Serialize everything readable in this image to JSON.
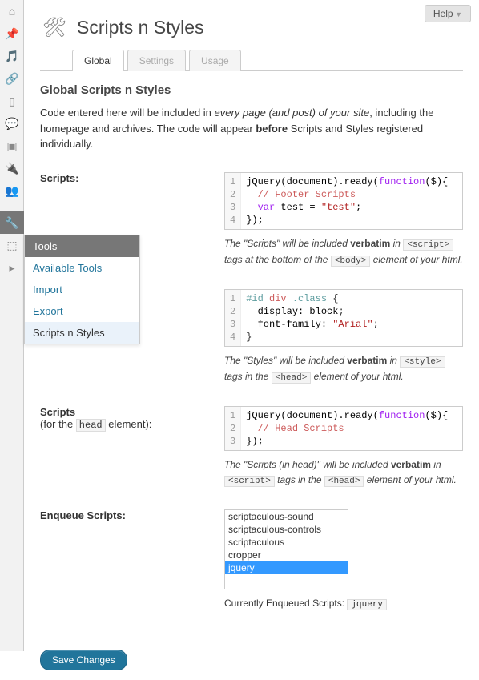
{
  "help_button": "Help",
  "page_title": "Scripts n Styles",
  "tabs": [
    {
      "label": "Global",
      "active": true
    },
    {
      "label": "Settings",
      "active": false
    },
    {
      "label": "Usage",
      "active": false
    }
  ],
  "section_title": "Global Scripts n Styles",
  "intro": {
    "p1a": "Code entered here will be included in ",
    "p1em": "every page (and post) of your site",
    "p1b": ", including the homepage and archives. The code will appear ",
    "p1strong": "before",
    "p1c": " Scripts and Styles registered individually."
  },
  "rows": {
    "scripts": {
      "label": "Scripts:",
      "code": [
        [
          {
            "t": "jQuery(document).ready(",
            "c": "jq"
          },
          {
            "t": "function",
            "c": "kw"
          },
          {
            "t": "($){",
            "c": "jq"
          }
        ],
        [
          {
            "t": "  // Footer Scripts",
            "c": "com"
          }
        ],
        [
          {
            "t": "  ",
            "c": "jq"
          },
          {
            "t": "var",
            "c": "kw"
          },
          {
            "t": " test = ",
            "c": "jq"
          },
          {
            "t": "\"test\"",
            "c": "str"
          },
          {
            "t": ";",
            "c": "jq"
          }
        ],
        [
          {
            "t": "});",
            "c": "jq"
          }
        ]
      ],
      "desc": {
        "a": "The \"Scripts\" will be included ",
        "strong": "verbatim",
        "b": " in ",
        "code1": "<script>",
        "c": " tags at the bottom of the ",
        "code2": "<body>",
        "d": " element of your html."
      }
    },
    "styles": {
      "code": [
        [
          {
            "t": "#id",
            "c": "sel"
          },
          {
            "t": " ",
            "c": ""
          },
          {
            "t": "div",
            "c": "tag"
          },
          {
            "t": " ",
            "c": ""
          },
          {
            "t": ".class",
            "c": "sel"
          },
          {
            "t": " {",
            "c": ""
          }
        ],
        [
          {
            "t": "  display: ",
            "c": "prop"
          },
          {
            "t": "block",
            "c": "jq"
          },
          {
            "t": ";",
            "c": ""
          }
        ],
        [
          {
            "t": "  font-family: ",
            "c": "prop"
          },
          {
            "t": "\"Arial\"",
            "c": "str"
          },
          {
            "t": ";",
            "c": ""
          }
        ],
        [
          {
            "t": "}",
            "c": ""
          }
        ]
      ],
      "desc": {
        "a": "The \"Styles\" will be included ",
        "strong": "verbatim",
        "b": " in ",
        "code1": "<style>",
        "c": " tags in the ",
        "code2": "<head>",
        "d": " element of your html."
      }
    },
    "head_scripts": {
      "label": "Scripts",
      "sub_a": "(for the ",
      "sub_code": "head",
      "sub_b": " element):",
      "code": [
        [
          {
            "t": "jQuery(document).ready(",
            "c": "jq"
          },
          {
            "t": "function",
            "c": "kw"
          },
          {
            "t": "($){",
            "c": "jq"
          }
        ],
        [
          {
            "t": "  // Head Scripts",
            "c": "com"
          }
        ],
        [
          {
            "t": "});",
            "c": "jq"
          }
        ]
      ],
      "desc": {
        "a": "The \"Scripts (in head)\" will be included ",
        "strong": "verbatim",
        "b": " in ",
        "code1": "<script>",
        "c": " tags in the ",
        "code2": "<head>",
        "d": " element of your html."
      }
    },
    "enqueue": {
      "label": "Enqueue Scripts:",
      "options": [
        {
          "label": "scriptaculous-sound",
          "selected": false
        },
        {
          "label": "scriptaculous-controls",
          "selected": false
        },
        {
          "label": "scriptaculous",
          "selected": false
        },
        {
          "label": "cropper",
          "selected": false
        },
        {
          "label": "jquery",
          "selected": true
        }
      ],
      "current_label": "Currently Enqueued Scripts:",
      "current_val": "jquery"
    }
  },
  "flyout": {
    "header": "Tools",
    "items": [
      {
        "label": "Available Tools",
        "current": false
      },
      {
        "label": "Import",
        "current": false
      },
      {
        "label": "Export",
        "current": false
      },
      {
        "label": "Scripts n Styles",
        "current": true
      }
    ]
  },
  "save_button": "Save Changes",
  "sidebar_icons": [
    "home",
    "pin",
    "media",
    "link",
    "page",
    "comment",
    "img",
    "plug",
    "users",
    "tools",
    "settings",
    "play"
  ]
}
